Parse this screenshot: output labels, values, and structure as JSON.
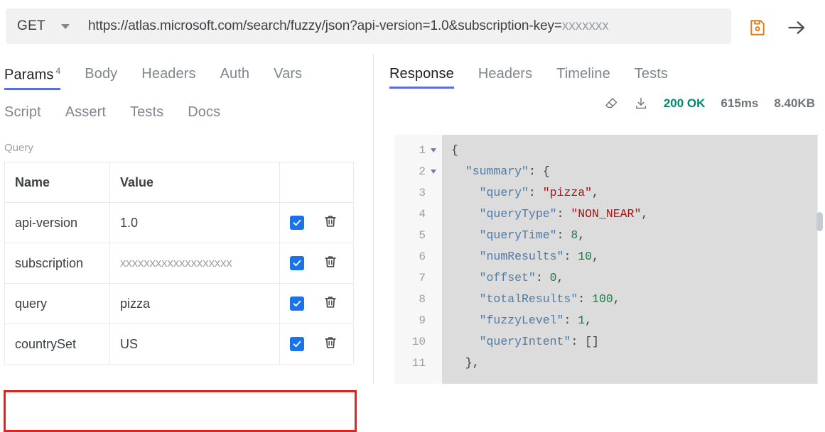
{
  "request_bar": {
    "method": "GET",
    "method_caret_icon": "chevron-down-icon",
    "url_visible": "https://atlas.microsoft.com/search/fuzzy/json?api-version=1.0&subscription-key=",
    "url_masked_suffix": "xxxxxxx",
    "save_icon": "floppy-disk-save-icon",
    "save_icon_color": "#e07b1a",
    "send_icon": "arrow-right-send-icon",
    "send_icon_color": "#4d4d4d"
  },
  "request_tabs": {
    "row1": [
      {
        "label": "Params",
        "badge": "4",
        "active": true
      },
      {
        "label": "Body",
        "badge": "",
        "active": false
      },
      {
        "label": "Headers",
        "badge": "",
        "active": false
      },
      {
        "label": "Auth",
        "badge": "",
        "active": false
      },
      {
        "label": "Vars",
        "badge": "",
        "active": false
      }
    ],
    "row2": [
      {
        "label": "Script",
        "badge": "",
        "active": false
      },
      {
        "label": "Assert",
        "badge": "",
        "active": false
      },
      {
        "label": "Tests",
        "badge": "",
        "active": false
      },
      {
        "label": "Docs",
        "badge": "",
        "active": false
      }
    ]
  },
  "params_section": {
    "group_label": "Query",
    "columns": [
      "Name",
      "Value",
      ""
    ],
    "rows": [
      {
        "name": "api-version",
        "value": "1.0",
        "value_masked": false,
        "enabled": true,
        "highlighted": false
      },
      {
        "name": "subscription",
        "value": "xxxxxxxxxxxxxxxxxxx",
        "value_masked": true,
        "enabled": true,
        "highlighted": false
      },
      {
        "name": "query",
        "value": "pizza",
        "value_masked": false,
        "enabled": true,
        "highlighted": false
      },
      {
        "name": "countrySet",
        "value": "US",
        "value_masked": false,
        "enabled": true,
        "highlighted": true
      }
    ],
    "checkbox_color": "#1a73e8",
    "highlight_color": "#e8201a",
    "delete_icon": "trash-icon",
    "enable_icon": "checkbox-checked-icon"
  },
  "response_tabs": [
    {
      "label": "Response",
      "active": true
    },
    {
      "label": "Headers",
      "active": false
    },
    {
      "label": "Timeline",
      "active": false
    },
    {
      "label": "Tests",
      "active": false
    }
  ],
  "response_status": {
    "clear_icon": "eraser-clear-icon",
    "download_icon": "download-icon",
    "status_code": "200 OK",
    "status_color": "#00866e",
    "time": "615ms",
    "size": "8.40KB"
  },
  "response_body": {
    "lines": [
      {
        "num": "1",
        "foldable": true,
        "tokens": [
          {
            "t": "p",
            "v": "{"
          }
        ]
      },
      {
        "num": "2",
        "foldable": true,
        "tokens": [
          {
            "t": "p",
            "v": "  "
          },
          {
            "t": "k",
            "v": "\"summary\""
          },
          {
            "t": "p",
            "v": ": {"
          }
        ]
      },
      {
        "num": "3",
        "foldable": false,
        "tokens": [
          {
            "t": "p",
            "v": "    "
          },
          {
            "t": "k",
            "v": "\"query\""
          },
          {
            "t": "p",
            "v": ": "
          },
          {
            "t": "s",
            "v": "\"pizza\""
          },
          {
            "t": "p",
            "v": ","
          }
        ]
      },
      {
        "num": "4",
        "foldable": false,
        "tokens": [
          {
            "t": "p",
            "v": "    "
          },
          {
            "t": "k",
            "v": "\"queryType\""
          },
          {
            "t": "p",
            "v": ": "
          },
          {
            "t": "s",
            "v": "\"NON_NEAR\""
          },
          {
            "t": "p",
            "v": ","
          }
        ]
      },
      {
        "num": "5",
        "foldable": false,
        "tokens": [
          {
            "t": "p",
            "v": "    "
          },
          {
            "t": "k",
            "v": "\"queryTime\""
          },
          {
            "t": "p",
            "v": ": "
          },
          {
            "t": "n",
            "v": "8"
          },
          {
            "t": "p",
            "v": ","
          }
        ]
      },
      {
        "num": "6",
        "foldable": false,
        "tokens": [
          {
            "t": "p",
            "v": "    "
          },
          {
            "t": "k",
            "v": "\"numResults\""
          },
          {
            "t": "p",
            "v": ": "
          },
          {
            "t": "n",
            "v": "10"
          },
          {
            "t": "p",
            "v": ","
          }
        ]
      },
      {
        "num": "7",
        "foldable": false,
        "tokens": [
          {
            "t": "p",
            "v": "    "
          },
          {
            "t": "k",
            "v": "\"offset\""
          },
          {
            "t": "p",
            "v": ": "
          },
          {
            "t": "n",
            "v": "0"
          },
          {
            "t": "p",
            "v": ","
          }
        ]
      },
      {
        "num": "8",
        "foldable": false,
        "tokens": [
          {
            "t": "p",
            "v": "    "
          },
          {
            "t": "k",
            "v": "\"totalResults\""
          },
          {
            "t": "p",
            "v": ": "
          },
          {
            "t": "n",
            "v": "100"
          },
          {
            "t": "p",
            "v": ","
          }
        ]
      },
      {
        "num": "9",
        "foldable": false,
        "tokens": [
          {
            "t": "p",
            "v": "    "
          },
          {
            "t": "k",
            "v": "\"fuzzyLevel\""
          },
          {
            "t": "p",
            "v": ": "
          },
          {
            "t": "n",
            "v": "1"
          },
          {
            "t": "p",
            "v": ","
          }
        ]
      },
      {
        "num": "10",
        "foldable": false,
        "tokens": [
          {
            "t": "p",
            "v": "    "
          },
          {
            "t": "k",
            "v": "\"queryIntent\""
          },
          {
            "t": "p",
            "v": ": []"
          }
        ]
      },
      {
        "num": "11",
        "foldable": false,
        "tokens": [
          {
            "t": "p",
            "v": "  },"
          }
        ]
      }
    ]
  }
}
